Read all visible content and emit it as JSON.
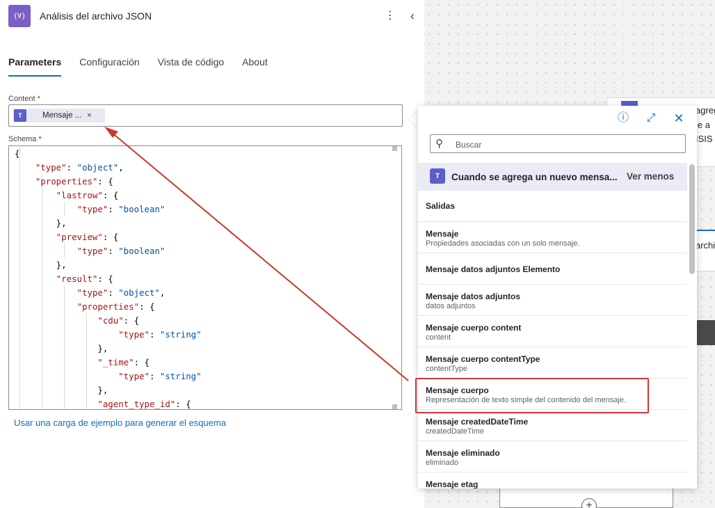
{
  "action": {
    "title": "Análisis del archivo JSON",
    "icon": "{∀}",
    "more_icon": "⋮",
    "collapse_icon": "‹"
  },
  "tabs": [
    {
      "label": "Parameters",
      "active": true
    },
    {
      "label": "Configuración",
      "active": false
    },
    {
      "label": "Vista de código",
      "active": false
    },
    {
      "label": "About",
      "active": false
    }
  ],
  "content": {
    "label": "Content",
    "required_mark": "*",
    "token_label": "Mensaje ...",
    "token_remove": "×"
  },
  "schema": {
    "label": "Schema",
    "required_mark": "*",
    "code_lines": [
      "{",
      "    \"type\": \"object\",",
      "    \"properties\": {",
      "        \"lastrow\": {",
      "            \"type\": \"boolean\"",
      "        },",
      "        \"preview\": {",
      "            \"type\": \"boolean\"",
      "        },",
      "        \"result\": {",
      "            \"type\": \"object\",",
      "            \"properties\": {",
      "                \"cdu\": {",
      "                    \"type\": \"string\"",
      "                },",
      "                \"_time\": {",
      "                    \"type\": \"string\"",
      "                },",
      "                \"agent_type_id\": {"
    ]
  },
  "sample_link": "Usar una carga de ejemplo para generar el esquema",
  "popup": {
    "search_placeholder": "Buscar",
    "trigger_title": "Cuando se agrega un nuevo mensa...",
    "see_less": "Ver menos",
    "items": [
      {
        "title": "Salidas",
        "desc": ""
      },
      {
        "title": "Mensaje",
        "desc": "Propiedades asociadas con un solo mensaje."
      },
      {
        "title": "Mensaje datos adjuntos Elemento",
        "desc": ""
      },
      {
        "title": "Mensaje datos adjuntos",
        "desc": "datos adjuntos"
      },
      {
        "title": "Mensaje cuerpo content",
        "desc": "content"
      },
      {
        "title": "Mensaje cuerpo contentType",
        "desc": "contentType"
      },
      {
        "title": "Mensaje cuerpo",
        "desc": "Representación de texto simple del contenido del mensaje."
      },
      {
        "title": "Mensaje createdDateTime",
        "desc": "createdDateTime"
      },
      {
        "title": "Mensaje eliminado",
        "desc": "eliminado"
      },
      {
        "title": "Mensaje etag",
        "desc": ""
      }
    ]
  },
  "canvas": {
    "fragments": [
      "agreg",
      "je a",
      "ISIS",
      "archi"
    ]
  },
  "colors": {
    "accent": "#0f6cbd",
    "teams": "#5b5fc7",
    "highlight": "#d13438",
    "arrow": "#c8382b"
  }
}
